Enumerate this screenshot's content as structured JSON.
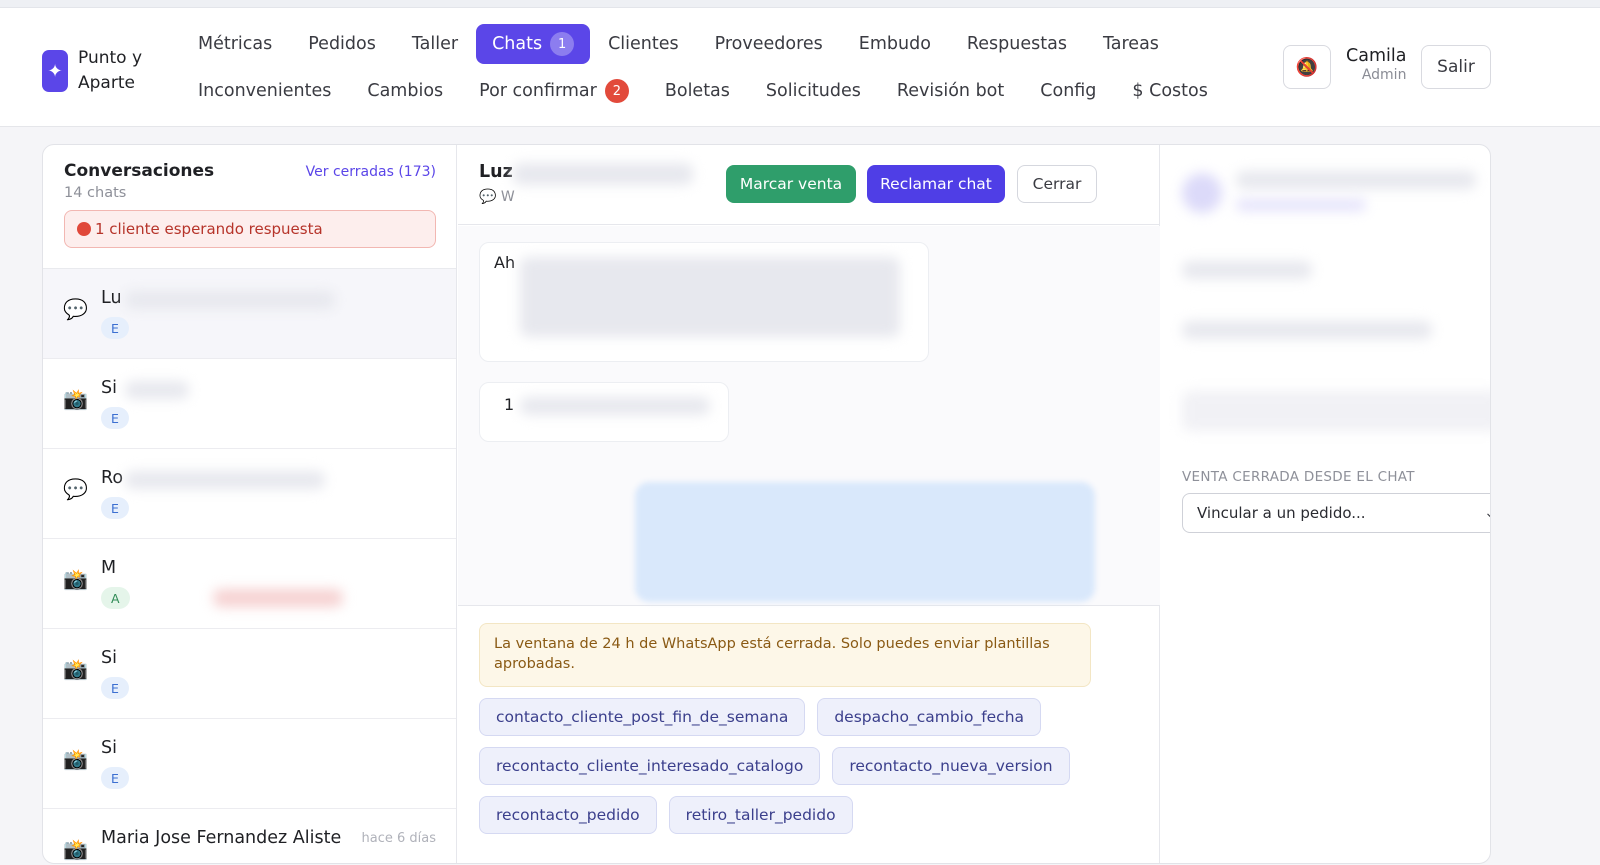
{
  "app": {
    "logo_line1": "Punto y",
    "logo_line2": "Aparte",
    "logo_icon": "sparkle-icon"
  },
  "nav": {
    "row1": [
      {
        "label": "Métricas"
      },
      {
        "label": "Pedidos"
      },
      {
        "label": "Taller"
      },
      {
        "label": "Chats",
        "badge": "1",
        "active": true
      },
      {
        "label": "Clientes"
      },
      {
        "label": "Proveedores"
      },
      {
        "label": "Embudo"
      },
      {
        "label": "Respuestas"
      },
      {
        "label": "Tareas"
      }
    ],
    "row2": [
      {
        "label": "Inconvenientes"
      },
      {
        "label": "Cambios"
      },
      {
        "label": "Por confirmar",
        "badge": "2"
      },
      {
        "label": "Boletas"
      },
      {
        "label": "Solicitudes"
      },
      {
        "label": "Revisión bot"
      },
      {
        "label": "Config"
      },
      {
        "label": "$ Costos"
      }
    ]
  },
  "header": {
    "bell_icon": "bell-muted-icon",
    "user_name": "Camila",
    "user_role": "Admin",
    "logout_label": "Salir"
  },
  "conversations": {
    "title": "Conversaciones",
    "closed_link": "Ver cerradas (173)",
    "count": "14 chats",
    "waiting_alert": "1 cliente esperando respuesta",
    "items": [
      {
        "icon": "💬",
        "name": "Lu",
        "tag": "E"
      },
      {
        "icon": "📸",
        "name": "Si",
        "tag": "E"
      },
      {
        "icon": "💬",
        "name": "Ro",
        "tag": "E"
      },
      {
        "icon": "📸",
        "name": "M",
        "tag": "A"
      },
      {
        "icon": "📸",
        "name": "Si",
        "tag": "E"
      },
      {
        "icon": "📸",
        "name": "Si",
        "tag": "E"
      },
      {
        "icon": "📸",
        "name": "Maria Jose Fernandez Aliste",
        "time": "hace 6 días"
      }
    ]
  },
  "chat": {
    "contact_name": "Luz",
    "channel": "💬 W",
    "mark_sale_label": "Marcar venta",
    "claim_label": "Reclamar chat",
    "close_label": "Cerrar",
    "msg1_start": "Ah",
    "msg2_start": "1",
    "warning": "La ventana de 24 h de WhatsApp está cerrada. Solo puedes enviar plantillas aprobadas.",
    "templates": [
      [
        "contacto_cliente_post_fin_de_semana",
        "despacho_cambio_fecha"
      ],
      [
        "recontacto_cliente_interesado_catalogo",
        "recontacto_nueva_version"
      ],
      [
        "recontacto_pedido",
        "retiro_taller_pedido"
      ]
    ]
  },
  "sidebar": {
    "sale_section_label": "VENTA CERRADA DESDE EL CHAT",
    "link_order_placeholder": "Vincular a un pedido..."
  },
  "colors": {
    "accent": "#5b46e8",
    "sale_green": "#2f9e6b",
    "alert_red": "#e0483a"
  }
}
